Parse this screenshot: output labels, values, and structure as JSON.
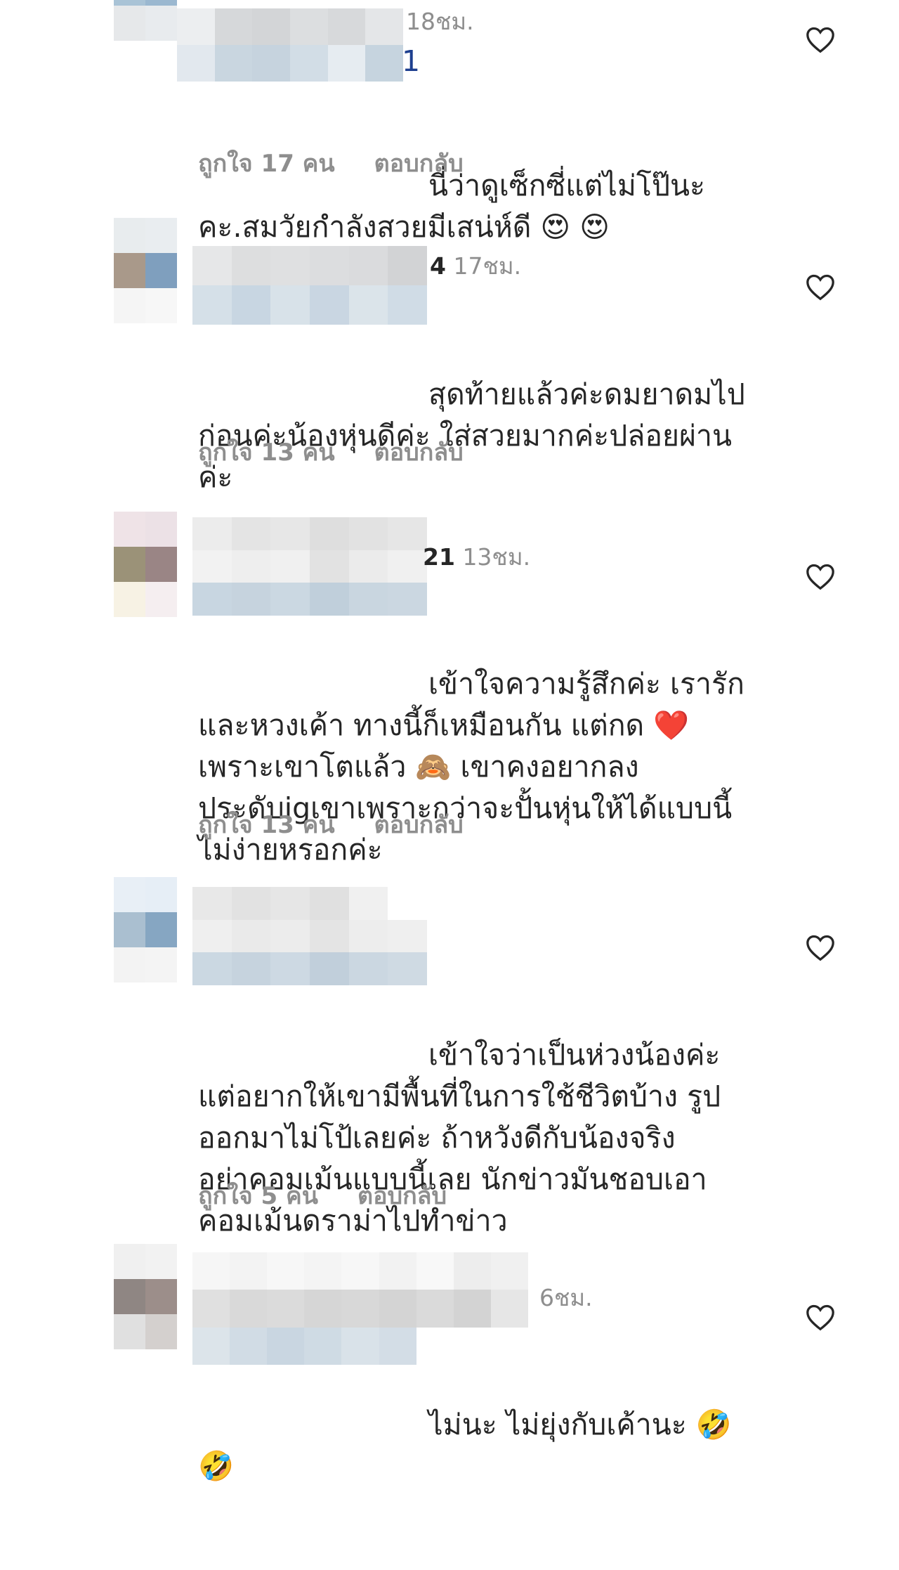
{
  "comments": [
    {
      "username_tail": "1",
      "time": "18ชม.",
      "text": " นี่ว่าดูเซ็กซี่แต่ไม่โป๊นะ\nคะ.สมวัยกำลังสวยมีเสน่ห์ดี 😍 😍",
      "likes": "ถูกใจ 17 คน",
      "reply": "ตอบกลับ"
    },
    {
      "username_tail": "4",
      "time": "17ชม.",
      "text": " สุดท้ายแล้วค่ะดมยาดมไป\nก่อนค่ะน้องหุ่นดีค่ะ ใส่สวยมากค่ะปล่อยผ่าน\nค่ะ",
      "likes": "ถูกใจ 13 คน",
      "reply": "ตอบกลับ"
    },
    {
      "username_tail": "21",
      "time": "13ชม.",
      "text": " เข้าใจความรู้สึกค่ะ เรารัก\nและหวงเค้า ทางนี้ก็เหมือนกัน แต่กด ❤️\nเพราะเขาโตแล้ว 🙈 เขาคงอยากลง\nประดับigเขาเพราะกว่าจะปั้นหุ่นให้ได้แบบนี้\nไม่ง่ายหรอกค่ะ",
      "likes": "ถูกใจ 13 คน",
      "reply": "ตอบกลับ"
    },
    {
      "username_tail": "",
      "time": "",
      "text": " เข้าใจว่าเป็นห่วงน้องค่ะ\nแต่อยากให้เขามีพื้นที่ในการใช้ชีวิตบ้าง รูป\nออกมาไม่โป้เลยค่ะ ถ้าหวังดีกับน้องจริง\nอย่าคอมเม้นแบบนี้เลย นักข่าวมันชอบเอา\nคอมเม้นดราม่าไปทำข่าว",
      "likes": "ถูกใจ 5 คน",
      "reply": "ตอบกลับ"
    },
    {
      "username_tail": "",
      "time": "6ชม.",
      "text": " ไม่นะ ไม่ยุ่งกับเค้านะ 🤣\n🤣",
      "likes": "",
      "reply": ""
    }
  ],
  "icons": {
    "like": "heart-outline-icon"
  },
  "colors": {
    "text": "#262626",
    "muted": "#8e8e8e"
  }
}
